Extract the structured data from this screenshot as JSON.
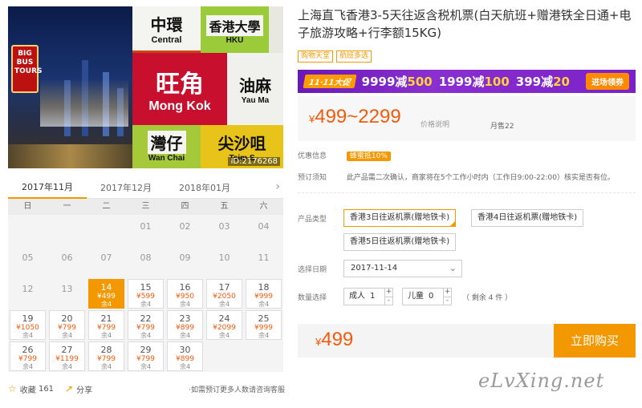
{
  "hero": {
    "bus_sign": "BIG BUS TOURS",
    "tiles": [
      {
        "zh": "中環",
        "en": "Central"
      },
      {
        "zh": "香港大學",
        "en": "HKU"
      },
      {
        "zh": "旺角",
        "en": "Mong Kok"
      },
      {
        "zh": "油麻",
        "en": "Yau Ma"
      },
      {
        "zh": "灣仔",
        "en": "Wan Chai"
      },
      {
        "zh": "尖沙咀",
        "en": "Tsim S"
      }
    ],
    "id_tag": "ID:2176268"
  },
  "calendar": {
    "months": [
      "2017年11月",
      "2017年12月",
      "2018年01月"
    ],
    "next_arrow": "›",
    "weekdays": [
      "日",
      "一",
      "二",
      "三",
      "四",
      "五",
      "六"
    ],
    "days": [
      {
        "d": "",
        "p": "",
        "r": ""
      },
      {
        "d": "",
        "p": "",
        "r": ""
      },
      {
        "d": "",
        "p": "",
        "r": ""
      },
      {
        "d": "01",
        "p": "",
        "r": ""
      },
      {
        "d": "02",
        "p": "",
        "r": ""
      },
      {
        "d": "03",
        "p": "",
        "r": ""
      },
      {
        "d": "04",
        "p": "",
        "r": ""
      },
      {
        "d": "05",
        "p": "",
        "r": ""
      },
      {
        "d": "06",
        "p": "",
        "r": ""
      },
      {
        "d": "07",
        "p": "",
        "r": ""
      },
      {
        "d": "08",
        "p": "",
        "r": ""
      },
      {
        "d": "09",
        "p": "",
        "r": ""
      },
      {
        "d": "10",
        "p": "",
        "r": ""
      },
      {
        "d": "11",
        "p": "",
        "r": ""
      },
      {
        "d": "12",
        "p": "",
        "r": ""
      },
      {
        "d": "13",
        "p": "",
        "r": ""
      },
      {
        "d": "14",
        "p": "¥499",
        "r": "余4",
        "sel": true
      },
      {
        "d": "15",
        "p": "¥599",
        "r": "余4"
      },
      {
        "d": "16",
        "p": "¥950",
        "r": "余4"
      },
      {
        "d": "17",
        "p": "¥2050",
        "r": "余4"
      },
      {
        "d": "18",
        "p": "¥999",
        "r": "余4"
      },
      {
        "d": "19",
        "p": "¥1050",
        "r": "余4"
      },
      {
        "d": "20",
        "p": "¥799",
        "r": "余4"
      },
      {
        "d": "21",
        "p": "¥799",
        "r": "余4"
      },
      {
        "d": "22",
        "p": "¥799",
        "r": "余4"
      },
      {
        "d": "23",
        "p": "¥899",
        "r": "余4"
      },
      {
        "d": "24",
        "p": "¥2099",
        "r": "余4"
      },
      {
        "d": "25",
        "p": "¥999",
        "r": "余4"
      },
      {
        "d": "26",
        "p": "¥799",
        "r": "余4"
      },
      {
        "d": "27",
        "p": "¥1199",
        "r": "余4"
      },
      {
        "d": "28",
        "p": "¥799",
        "r": "余4"
      },
      {
        "d": "29",
        "p": "¥799",
        "r": "余4"
      },
      {
        "d": "30",
        "p": "¥899",
        "r": "余4"
      }
    ]
  },
  "social": {
    "fav_label": "收藏",
    "fav_count": "161",
    "share_label": "分享",
    "hint": "·如需预订更多人数请咨询客服"
  },
  "product": {
    "title": "上海直飞香港3-5天往返含税机票(白天航班+赠港铁全日通+电子旅游攻略+行李额15KG)",
    "tags": [
      "购物天堂",
      "航班多选"
    ]
  },
  "promo": {
    "badge": "11·11大促",
    "deals": [
      {
        "a": "9999减",
        "b": "500"
      },
      {
        "a": "1999减",
        "b": "100"
      },
      {
        "a": "399减",
        "b": "20"
      }
    ],
    "cta": "进场领券"
  },
  "price": {
    "currency": "¥",
    "range": "499~2299",
    "explain": "价格说明",
    "sales": "月售22"
  },
  "info": {
    "youhui_label": "优惠信息",
    "youhui_badge": "蜂蜜抵10%",
    "notice_label": "预订须知",
    "notice_text": "此产品需二次确认，商家将在5个工作小时内（工作日9:00-22:00）核实是否有位。"
  },
  "options": {
    "type_label": "产品类型",
    "types": [
      "香港3日往返机票(赠地铁卡)",
      "香港4日往返机票(赠地铁卡)",
      "香港5日往返机票(赠地铁卡)"
    ],
    "date_label": "选择日期",
    "date_value": "2017-11-14",
    "qty_label": "数量选择",
    "adult_label": "成人",
    "adult_value": "1",
    "child_label": "儿童",
    "child_value": "0",
    "remaining": "（ 剩余 4 件 ）"
  },
  "buy": {
    "currency": "¥",
    "price": "499",
    "button": "立即购买"
  },
  "watermark": "eLvXing.net"
}
